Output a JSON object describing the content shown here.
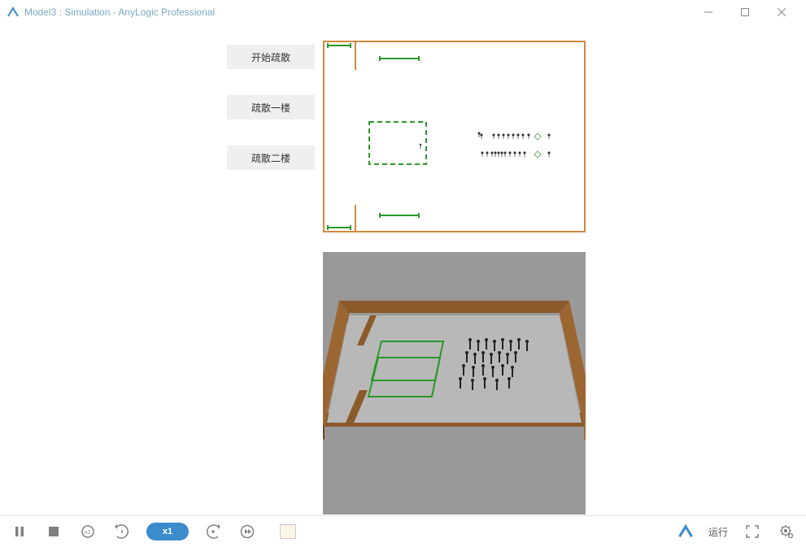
{
  "window": {
    "title": "Model3 : Simulation - AnyLogic Professional"
  },
  "buttons": {
    "start": "开始疏散",
    "floor1": "疏散一楼",
    "floor2": "疏散二楼"
  },
  "bottombar": {
    "speed": "x1",
    "status": "运行"
  },
  "colors": {
    "wall": "#d18840",
    "zone": "#2a9828",
    "accent": "#3b8ccc",
    "titleText": "#7aa8c4"
  }
}
